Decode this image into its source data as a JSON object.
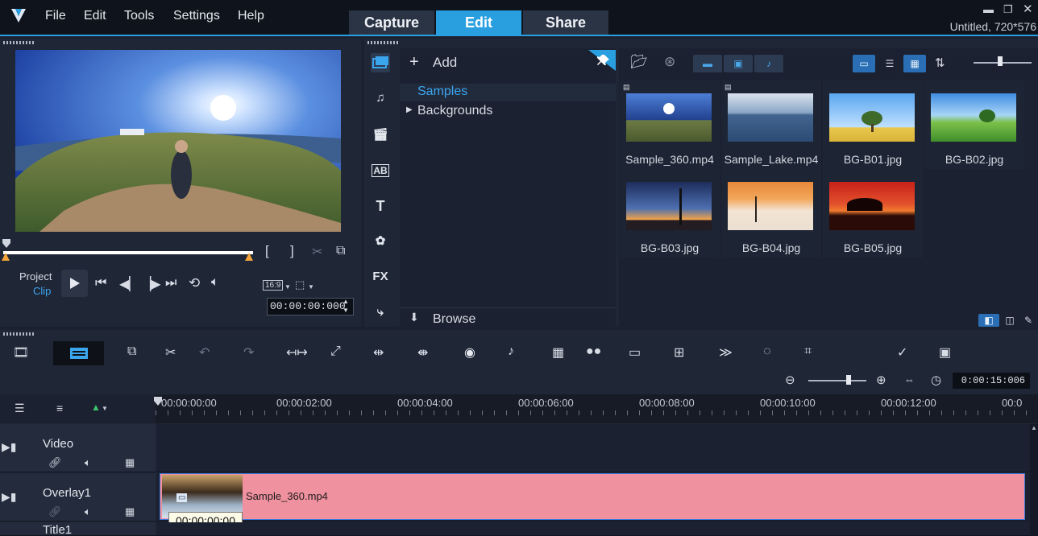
{
  "menu": {
    "file": "File",
    "edit": "Edit",
    "tools": "Tools",
    "settings": "Settings",
    "help": "Help"
  },
  "modes": {
    "capture": "Capture",
    "edit": "Edit",
    "share": "Share"
  },
  "window": {
    "project_title": "Untitled, 720*576"
  },
  "player": {
    "project_label": "Project",
    "clip_label": "Clip",
    "aspect_ratio": "16:9",
    "timecode": "00:00:00:000"
  },
  "library": {
    "add_label": "Add",
    "tree": [
      "Samples",
      "Backgrounds"
    ],
    "browse_label": "Browse",
    "items": [
      {
        "label": "Sample_360.mp4"
      },
      {
        "label": "Sample_Lake.mp4"
      },
      {
        "label": "BG-B01.jpg"
      },
      {
        "label": "BG-B02.jpg"
      },
      {
        "label": "BG-B03.jpg"
      },
      {
        "label": "BG-B04.jpg"
      },
      {
        "label": "BG-B05.jpg"
      }
    ],
    "sidebar": {
      "title_icon_text": "AB",
      "text_icon": "T",
      "fx_icon": "FX"
    }
  },
  "timeline": {
    "duration": "0:00:15:006",
    "ticks": [
      "00:00:00:00",
      "00:00:02:00",
      "00:00:04:00",
      "00:00:06:00",
      "00:00:08:00",
      "00:00:10:00",
      "00:00:12:00",
      "00:0"
    ],
    "tracks": {
      "video": "Video",
      "overlay": "Overlay1",
      "title": "Title1"
    },
    "clip_label": "Sample_360.mp4",
    "tooltip": "00:00:00:00"
  },
  "colors": {
    "accent": "#2a9fe0",
    "clip": "#f0919f"
  }
}
